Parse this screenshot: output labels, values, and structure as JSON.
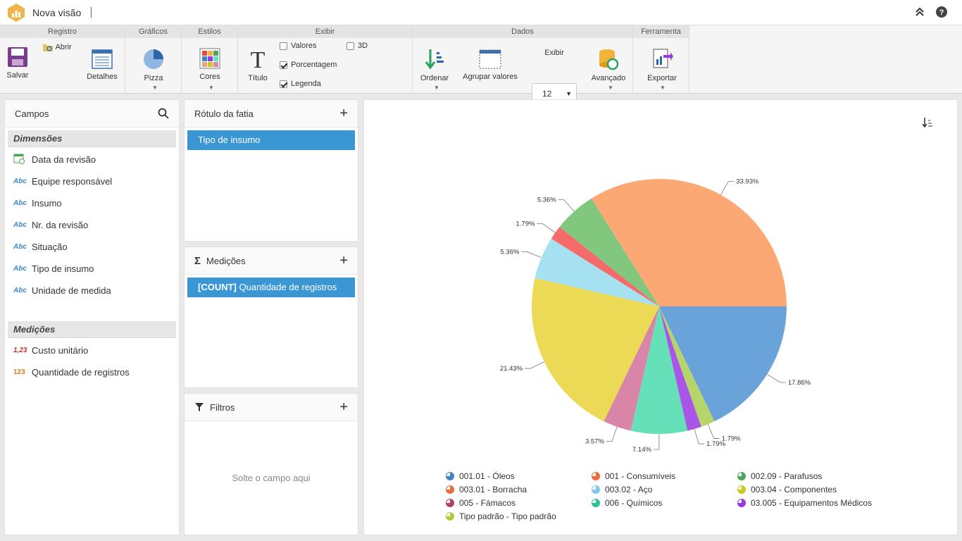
{
  "app": {
    "title": "Nova visão"
  },
  "ribbon": {
    "groups": {
      "registro": "Registro",
      "graficos": "Gráficos",
      "estilos": "Estilos",
      "exibir": "Exibir",
      "dados": "Dados",
      "ferramenta": "Ferramenta"
    },
    "buttons": {
      "salvar": "Salvar",
      "abrir": "Abrir",
      "detalhes": "Detalhes",
      "pizza": "Pizza",
      "cores": "Cores",
      "titulo": "Título",
      "ordenar": "Ordenar",
      "agrupar": "Agrupar valores",
      "exibir_label": "Exibir",
      "avancado": "Avançado",
      "exportar": "Exportar"
    },
    "checks": {
      "valores": {
        "label": "Valores",
        "checked": false
      },
      "tres_d": {
        "label": "3D",
        "checked": false
      },
      "porcentagem": {
        "label": "Porcentagem",
        "checked": true
      },
      "legenda": {
        "label": "Legenda",
        "checked": true
      }
    },
    "exibir_value": "12"
  },
  "fields_panel": {
    "title": "Campos",
    "dimensions_title": "Dimensões",
    "dimensions": [
      {
        "icon": "calendar-icon",
        "label": "Data da revisão"
      },
      {
        "icon": "abc-icon",
        "label": "Equipe responsável"
      },
      {
        "icon": "abc-icon",
        "label": "Insumo"
      },
      {
        "icon": "abc-icon",
        "label": "Nr. da revisão"
      },
      {
        "icon": "abc-icon",
        "label": "Situação"
      },
      {
        "icon": "abc-icon",
        "label": "Tipo de insumo"
      },
      {
        "icon": "abc-icon",
        "label": "Unidade de medida"
      }
    ],
    "measures_title": "Medições",
    "measures": [
      {
        "icon": "decimal-icon",
        "icon_text": "1,23",
        "label": "Custo unitário"
      },
      {
        "icon": "integer-icon",
        "icon_text": "123",
        "label": "Quantidade de registros"
      }
    ],
    "abc_text": "Abc"
  },
  "slice_panel": {
    "title": "Rótulo da fatia",
    "chip": "Tipo de insumo"
  },
  "measures_panel": {
    "title": "Medições",
    "chip_prefix": "[COUNT]",
    "chip_text": "Quantidade de registros"
  },
  "filters_panel": {
    "title": "Filtros",
    "hint": "Solte o campo aqui"
  },
  "chart_data": {
    "type": "pie",
    "slices": [
      {
        "label": "001.01 - Óleos",
        "value": 17.86,
        "color": "#6aa3d9"
      },
      {
        "label": "Tipo padrão - Tipo padrão",
        "value": 1.79,
        "color": "#b5d46a"
      },
      {
        "label": "03.005 - Equipamentos Médicos",
        "value": 1.79,
        "color": "#a855e8"
      },
      {
        "label": "006 - Químicos",
        "value": 7.14,
        "color": "#66e0b8"
      },
      {
        "label": "005 - Fámacos",
        "value": 3.57,
        "color": "#d985a8"
      },
      {
        "label": "003.04 - Componentes",
        "value": 21.43,
        "color": "#ecd955"
      },
      {
        "label": "003.02 - Aço",
        "value": 5.36,
        "color": "#a6e1f2"
      },
      {
        "label": "003.01 - Borracha",
        "value": 1.79,
        "color": "#f56a6a"
      },
      {
        "label": "002.09 - Parafusos",
        "value": 5.36,
        "color": "#82c77e"
      },
      {
        "label": "001 - Consumíveis",
        "value": 33.93,
        "color": "#fba874"
      }
    ],
    "value_labels": [
      "17.86%",
      "1.79%",
      "1.79%",
      "7.14%",
      "3.57%",
      "21.43%",
      "5.36%",
      "1.79%",
      "5.36%",
      "33.93%"
    ],
    "legend": [
      {
        "label": "001.01 - Óleos",
        "color": "#3d86c6"
      },
      {
        "label": "001 - Consumíveis",
        "color": "#ee6a3a"
      },
      {
        "label": "002.09 - Parafusos",
        "color": "#4aa55a"
      },
      {
        "label": "003.01 - Borracha",
        "color": "#ee6a3a"
      },
      {
        "label": "003.02 - Aço",
        "color": "#7dcbe8"
      },
      {
        "label": "003.04 - Componentes",
        "color": "#c8c920"
      },
      {
        "label": "005 - Fámacos",
        "color": "#b0406a"
      },
      {
        "label": "006 - Químicos",
        "color": "#2fbf96"
      },
      {
        "label": "03.005 - Equipamentos Médicos",
        "color": "#9a36de"
      },
      {
        "label": "Tipo padrão - Tipo padrão",
        "color": "#b6c83a"
      }
    ]
  }
}
